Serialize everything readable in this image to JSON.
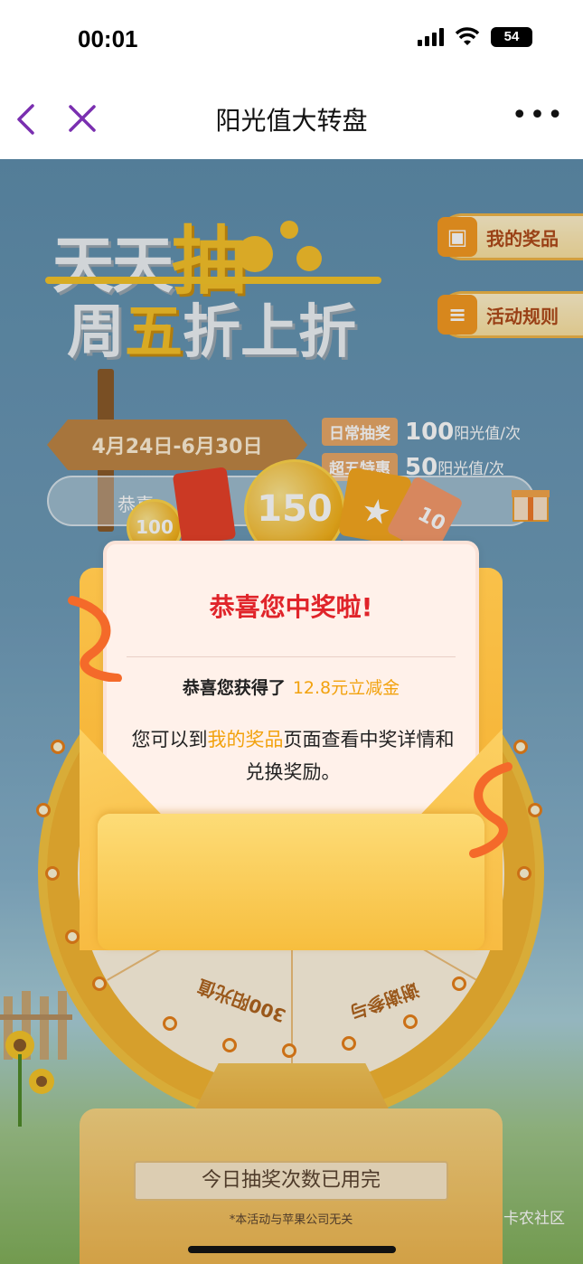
{
  "status_bar": {
    "time": "00:01",
    "battery": "54"
  },
  "nav": {
    "title": "阳光值大转盘",
    "more": "•••"
  },
  "hero": {
    "line1_a": "天天",
    "line1_b": "抽",
    "line2_a": "周",
    "line2_b": "五",
    "line2_c": "折上折"
  },
  "side_buttons": {
    "my_prizes": "我的奖品",
    "rules": "活动规则"
  },
  "date_sign": "4月24日-6月30日",
  "pricing": [
    {
      "tag": "日常抽奖",
      "value": "100",
      "unit": "阳光值/次"
    },
    {
      "tag": "超五特惠",
      "value": "50",
      "unit": "阳光值/次"
    }
  ],
  "marquee_text": "恭喜",
  "coins": {
    "small": "100",
    "big": "150",
    "ticket": "10"
  },
  "wheel": {
    "seg_left": "300阳光值",
    "seg_right": "谢谢参与"
  },
  "draw_button": "今日抽奖次数已用完",
  "disclaimer": "*本活动与苹果公司无关",
  "watermark": "卡农社区",
  "modal": {
    "title": "恭喜您中奖啦!",
    "line1": "恭喜您获得了",
    "prize": "12.8元立减金",
    "line2_pre": "您可以到",
    "line2_link": "我的奖品",
    "line2_post": "页面查看中奖详情和兑换奖励。"
  },
  "colors": {
    "accent_purple": "#7a2fb0",
    "prize_orange": "#f2a20e",
    "title_red": "#e0242a"
  }
}
